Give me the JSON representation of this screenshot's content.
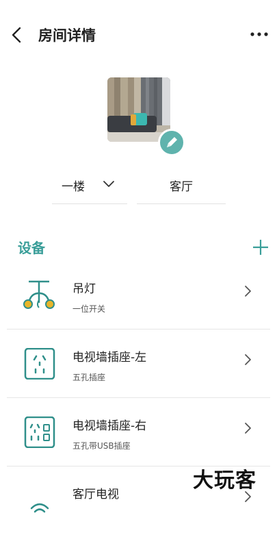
{
  "header": {
    "title": "房间详情",
    "back_icon": "chevron-left-icon",
    "more_icon": "more-horizontal-icon"
  },
  "room": {
    "floor": "一楼",
    "name": "客厅"
  },
  "devices_section": {
    "title": "设备",
    "add_icon": "plus-icon"
  },
  "devices": [
    {
      "name": "吊灯",
      "type": "一位开关",
      "icon": "pendant-lamp-icon"
    },
    {
      "name": "电视墙插座-左",
      "type": "五孔插座",
      "icon": "socket-five-hole-icon"
    },
    {
      "name": "电视墙插座-右",
      "type": "五孔带USB插座",
      "icon": "socket-usb-icon"
    },
    {
      "name": "客厅电视",
      "icon": "wifi-icon"
    }
  ],
  "watermark": "大玩客",
  "colors": {
    "accent": "#3a9e99",
    "icon_teal": "#2f8f8a",
    "lamp_yellow": "#e8b52a",
    "edit_button": "#5fb3ad"
  }
}
